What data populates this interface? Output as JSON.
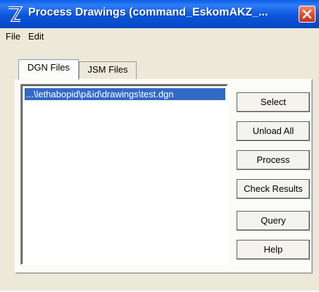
{
  "window": {
    "title": "Process Drawings (command_EskomAKZ_...",
    "close_label": "X"
  },
  "menu": [
    "File",
    "Edit"
  ],
  "tabs": [
    {
      "label": "DGN Files",
      "active": true
    },
    {
      "label": "JSM Files",
      "active": false
    }
  ],
  "files": [
    "...\\lethabopid\\p&id\\drawings\\test.dgn"
  ],
  "buttons": {
    "select": "Select",
    "unload_all": "Unload All",
    "process": "Process",
    "check_results": "Check Results",
    "query": "Query",
    "help": "Help"
  },
  "colors": {
    "titlebar": "#0a56dc",
    "selection": "#316ac5",
    "close": "#d8482a"
  }
}
